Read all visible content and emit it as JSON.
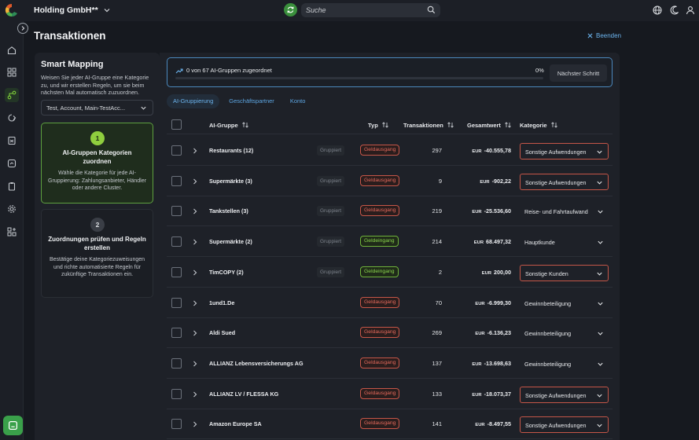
{
  "header": {
    "company": "Holding GmbH**",
    "search_placeholder": "Suche"
  },
  "page": {
    "title": "Transaktionen",
    "close_label": "Beenden"
  },
  "smart_mapping": {
    "title": "Smart Mapping",
    "description": "Weisen Sie jeder AI-Gruppe eine Kategorie zu, und wir erstellen Regeln, um sie beim nächsten Mal automatisch zuzuordnen.",
    "select_value": "Test, Account, Main-TestAcc...",
    "steps": [
      {
        "number": "1",
        "title": "AI-Gruppen Kategorien zuordnen",
        "description": "Wähle die Kategorie für jede AI-Gruppierung: Zahlungsanbieter, Händler oder andere Cluster."
      },
      {
        "number": "2",
        "title": "Zuordnungen prüfen und Regeln erstellen",
        "description": "Bestätige deine Kategoriezuweisungen und richte automatisierte Regeln für zukünftige Transaktionen ein."
      }
    ]
  },
  "progress": {
    "text": "0 von 67 AI-Gruppen zugeordnet",
    "percent_label": "0%",
    "fraction": 0,
    "next_button": "Nächster Schritt"
  },
  "tabs": [
    "AI-Gruppierung",
    "Geschäftspartner",
    "Konto"
  ],
  "table": {
    "headers": {
      "group": "AI-Gruppe",
      "type": "Typ",
      "transactions": "Transaktionen",
      "total": "Gesamtwert",
      "category": "Kategorie"
    },
    "rows": [
      {
        "name": "Restaurants (12)",
        "grouped": "Gruppiert",
        "type": "Geldausgang",
        "direction": "out",
        "count": "297",
        "currency": "EUR",
        "amount": "-40.555,78",
        "category": "Sonstige Aufwendungen",
        "boxed": true
      },
      {
        "name": "Supermärkte (3)",
        "grouped": "Gruppiert",
        "type": "Geldausgang",
        "direction": "out",
        "count": "9",
        "currency": "EUR",
        "amount": "-902,22",
        "category": "Sonstige Aufwendungen",
        "boxed": true
      },
      {
        "name": "Tankstellen (3)",
        "grouped": "Gruppiert",
        "type": "Geldausgang",
        "direction": "out",
        "count": "219",
        "currency": "EUR",
        "amount": "-25.536,60",
        "category": "Reise- und Fahrtaufwand",
        "boxed": false
      },
      {
        "name": "Supermärkte (2)",
        "grouped": "Gruppiert",
        "type": "Geldeingang",
        "direction": "in",
        "count": "214",
        "currency": "EUR",
        "amount": "68.497,32",
        "category": "Hauptkunde",
        "boxed": false
      },
      {
        "name": "TimCOPY (2)",
        "grouped": "Gruppiert",
        "type": "Geldeingang",
        "direction": "in",
        "count": "2",
        "currency": "EUR",
        "amount": "200,00",
        "category": "Sonstige Kunden",
        "boxed": true
      },
      {
        "name": "1und1.De",
        "grouped": "",
        "type": "Geldausgang",
        "direction": "out",
        "count": "70",
        "currency": "EUR",
        "amount": "-6.999,30",
        "category": "Gewinnbeteiligung",
        "boxed": false
      },
      {
        "name": "Aldi Sued",
        "grouped": "",
        "type": "Geldausgang",
        "direction": "out",
        "count": "269",
        "currency": "EUR",
        "amount": "-6.136,23",
        "category": "Gewinnbeteiligung",
        "boxed": false
      },
      {
        "name": "ALLIANZ Lebensversicherungs AG",
        "grouped": "",
        "type": "Geldausgang",
        "direction": "out",
        "count": "137",
        "currency": "EUR",
        "amount": "-13.698,63",
        "category": "Gewinnbeteiligung",
        "boxed": false
      },
      {
        "name": "ALLIANZ LV / FLESSA KG",
        "grouped": "",
        "type": "Geldausgang",
        "direction": "out",
        "count": "133",
        "currency": "EUR",
        "amount": "-18.073,37",
        "category": "Sonstige Aufwendungen",
        "boxed": true
      },
      {
        "name": "Amazon Europe SA",
        "grouped": "",
        "type": "Geldausgang",
        "direction": "out",
        "count": "141",
        "currency": "EUR",
        "amount": "-8.497,55",
        "category": "Sonstige Aufwendungen",
        "boxed": true
      }
    ]
  },
  "icons": {
    "logo": "app-logo-icon",
    "sync": "sync-icon",
    "search": "search-icon",
    "top_right": [
      "globe-icon",
      "moon-icon",
      "user-icon"
    ],
    "sidebar": [
      "home-icon",
      "dashboard-icon",
      "transactions-icon",
      "payment-icon",
      "document-icon",
      "analytics-icon",
      "clipboard-icon",
      "settings-icon",
      "apps-icon"
    ],
    "chat": "chat-icon"
  },
  "colors": {
    "accent_green": "#5ea040",
    "accent_blue": "#6cb4ee",
    "out_red": "#e4695b",
    "in_green": "#8ad64d"
  }
}
